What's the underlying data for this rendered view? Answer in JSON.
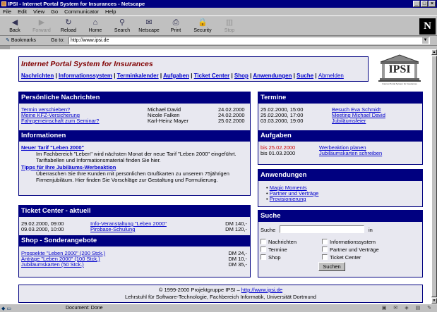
{
  "window": {
    "title": "IPSI - Internet Portal System for Insurances - Netscape",
    "controls": [
      "_",
      "□",
      "×"
    ]
  },
  "menu": [
    "File",
    "Edit",
    "View",
    "Go",
    "Communicator",
    "Help"
  ],
  "toolbar": {
    "buttons": [
      {
        "label": "Back",
        "icon": "back-arrow-icon",
        "glyph": "◀"
      },
      {
        "label": "Forward",
        "icon": "forward-arrow-icon",
        "glyph": "▶"
      },
      {
        "label": "Reload",
        "icon": "reload-icon",
        "glyph": "↻"
      },
      {
        "label": "Home",
        "icon": "home-icon",
        "glyph": "⌂"
      },
      {
        "label": "Search",
        "icon": "search-icon",
        "glyph": "⚲"
      },
      {
        "label": "Netscape",
        "icon": "netscape-icon",
        "glyph": "✉"
      },
      {
        "label": "Print",
        "icon": "print-icon",
        "glyph": "⎙"
      },
      {
        "label": "Security",
        "icon": "lock-icon",
        "glyph": "🔒"
      },
      {
        "label": "Stop",
        "icon": "stop-icon",
        "glyph": "▥"
      }
    ],
    "logo": "N"
  },
  "location": {
    "bookmarks_label": "Bookmarks",
    "goto_label": "Go to:",
    "url": "http://www.ipsi.de"
  },
  "site": {
    "title": "Internet Portal System for Insurances",
    "nav": [
      "Nachrichten",
      "Informationssystem",
      "Terminkalender",
      "Aufgaben",
      "Ticket Center",
      "Shop",
      "Anwendungen",
      "Suche"
    ],
    "nav_logout": "Abmelden",
    "logo_text": "IPSI",
    "logo_sub": "Internet Portal System for Insurances"
  },
  "news": {
    "heading": "Persönliche Nachrichten",
    "items": [
      {
        "subject": "Termin verschieben?",
        "from": "Michael David",
        "date": "24.02.2000"
      },
      {
        "subject": "Meine KFZ-Versicherung",
        "from": "Nicole Falken",
        "date": "24.02.2000"
      },
      {
        "subject": "Fahrgemeinschaft zum Seminar?",
        "from": "Karl-Heinz Mayer",
        "date": "25.02.2000"
      }
    ]
  },
  "info": {
    "heading": "Informationen",
    "items": [
      {
        "title": "Neuer Tarif \"Leben 2000\"",
        "text": "Im Fachbereich \"Leben\" wird nächsten Monat der neue Tarif \"Leben 2000\" eingeführt. Tariftabellen und Informationsmaterial finden Sie hier."
      },
      {
        "title": "Tipps für Ihre Jubiläums-Werbeaktion",
        "text": "Überraschen Sie Ihre Kunden mit persönlichen Grußkarten zu unserem 75jährigen Firmenjubiläum. Hier finden Sie Vorschläge zur Gestaltung und Formulierung."
      }
    ]
  },
  "termine": {
    "heading": "Termine",
    "items": [
      {
        "when": "25.02.2000, 15:00",
        "what": "Besuch Eva Schmidt"
      },
      {
        "when": "25.02.2000, 17:00",
        "what": "Meeting Michael David"
      },
      {
        "when": "03.03.2000, 19:00",
        "what": "Jubiläumsfeier"
      }
    ]
  },
  "aufgaben": {
    "heading": "Aufgaben",
    "items": [
      {
        "due": "bis 25.02.2000",
        "task": "Werbeaktion planen",
        "overdue": true
      },
      {
        "due": "bis 01.03.2000",
        "task": "Jubiläumskarten schreiben",
        "overdue": false
      }
    ]
  },
  "anwendungen": {
    "heading": "Anwendungen",
    "items": [
      "Magic Moments",
      "Partner und Verträge",
      "Provisionierung"
    ]
  },
  "tickets": {
    "heading": "Ticket Center - aktuell",
    "items": [
      {
        "when": "29.02.2000, 09:00",
        "what": "Info-Veranstaltung \"Leben 2000\"",
        "price": "DM 140,-"
      },
      {
        "when": "09.03.2000, 10:00",
        "what": "Pirobase-Schulung",
        "price": "DM 120,-"
      }
    ]
  },
  "shop": {
    "heading": "Shop - Sonderangebote",
    "items": [
      {
        "name": "Prospekte \"Leben 2000\" (200 Stck.)",
        "price": "DM 24,-"
      },
      {
        "name": "Anträge \"Leben 2000\" (100 Stck.)",
        "price": "DM 10,-"
      },
      {
        "name": "Jubiläumskarten (50 Stck.)",
        "price": "DM 35,-"
      }
    ]
  },
  "suche": {
    "heading": "Suche",
    "label": "Suche",
    "in_label": "in",
    "options": [
      "Nachrichten",
      "Informationssystem",
      "Termine",
      "Partner und Verträge",
      "Shop",
      "Ticket Center"
    ],
    "button": "Suchen"
  },
  "footer": {
    "copyright": "© 1999-2000 Projektgruppe IPSI –",
    "link": "http://www.ipsi.de",
    "line2": "Lehrstuhl für Software-Technologie, Fachbereich Informatik, Universität Dortmund"
  },
  "status": {
    "text": "Document: Done"
  }
}
